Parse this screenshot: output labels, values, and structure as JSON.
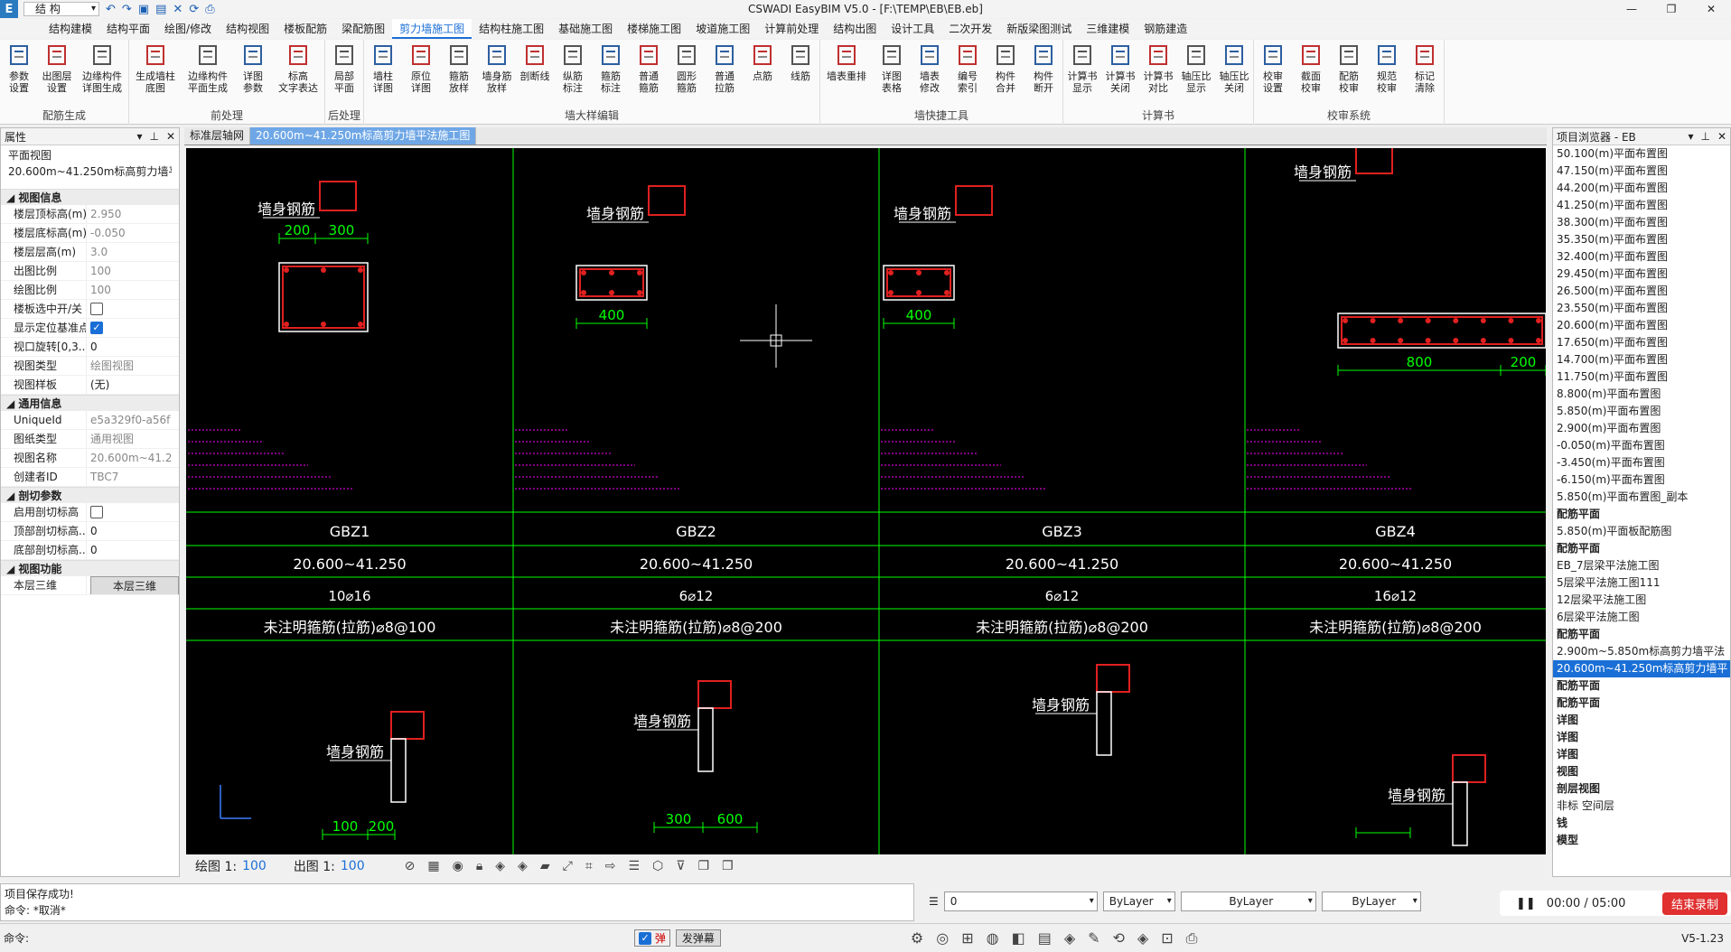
{
  "window": {
    "title": "CSWADI EasyBIM V5.0 - [F:\\TEMP\\EB\\EB.eb]",
    "profile": "结 构",
    "app_icon": "E"
  },
  "tabs": [
    "结构建模",
    "结构平面",
    "绘图/修改",
    "结构视图",
    "楼板配筋",
    "梁配筋图",
    "剪力墙施工图",
    "结构柱施工图",
    "基础施工图",
    "楼梯施工图",
    "坡道施工图",
    "计算前处理",
    "结构出图",
    "设计工具",
    "二次开发",
    "新版梁图测试",
    "三维建模",
    "钢筋建造"
  ],
  "active_tab": 6,
  "ribbon": [
    {
      "label": "配筋生成",
      "buttons": [
        "参数\n设置",
        "出图层\n设置",
        "边缘构件\n详图生成"
      ],
      "wide": [
        false,
        false,
        true
      ]
    },
    {
      "label": "前处理",
      "buttons": [
        "生成墙柱\n底图",
        "边缘构件\n平面生成",
        "详图\n参数",
        "标高\n文字表达"
      ],
      "wide": [
        true,
        true,
        false,
        true
      ]
    },
    {
      "label": "后处理",
      "buttons": [
        "局部\n平面"
      ],
      "wide": [
        false
      ]
    },
    {
      "label": "墙大样编辑",
      "buttons": [
        "墙柱\n详图",
        "原位\n详图",
        "箍筋\n放样",
        "墙身筋\n放样",
        "剖断线",
        "纵筋\n标注",
        "箍筋\n标注",
        "普通\n箍筋",
        "圆形\n箍筋",
        "普通\n拉筋",
        "点筋",
        "线筋"
      ],
      "wide": [
        false,
        false,
        false,
        false,
        false,
        false,
        false,
        false,
        false,
        false,
        false,
        false
      ]
    },
    {
      "label": "墙快捷工具",
      "buttons": [
        "墙表重排",
        "详图\n表格",
        "墙表\n修改",
        "编号\n索引",
        "构件\n合并",
        "构件\n断开"
      ],
      "wide": [
        true,
        false,
        false,
        false,
        false,
        false
      ]
    },
    {
      "label": "计算书",
      "buttons": [
        "计算书\n显示",
        "计算书\n关闭",
        "计算书\n对比",
        "轴压比\n显示",
        "轴压比\n关闭"
      ],
      "wide": [
        false,
        false,
        false,
        false,
        false
      ]
    },
    {
      "label": "校审系统",
      "buttons": [
        "校审\n设置",
        "截面\n校审",
        "配筋\n校审",
        "规范\n校审",
        "标记\n清除"
      ],
      "wide": [
        false,
        false,
        false,
        false,
        false
      ]
    }
  ],
  "props": {
    "title": "属性",
    "view_type_label": "平面视图",
    "view_name": "20.600m~41.250m标高剪力墙平法",
    "categories": [
      {
        "name": "视图信息",
        "rows": [
          [
            "楼层顶标高(m)",
            "2.950"
          ],
          [
            "楼层底标高(m)",
            "-0.050"
          ],
          [
            "楼层层高(m)",
            "3.0"
          ],
          [
            "出图比例",
            "100"
          ],
          [
            "绘图比例",
            "100"
          ],
          [
            "楼板选中开/关",
            "☐"
          ],
          [
            "显示定位基准点",
            "☑"
          ],
          [
            "视口旋转[0,3...",
            "0"
          ],
          [
            "视图类型",
            "绘图视图"
          ],
          [
            "视图样板",
            "(无)"
          ]
        ]
      },
      {
        "name": "通用信息",
        "rows": [
          [
            "UniqueId",
            "e5a329f0-a56f"
          ],
          [
            "图纸类型",
            "通用视图"
          ],
          [
            "视图名称",
            "20.600m~41.2"
          ],
          [
            "创建者ID",
            "TBC7"
          ]
        ]
      },
      {
        "name": "剖切参数",
        "rows": [
          [
            "启用剖切标高",
            "☐"
          ],
          [
            "顶部剖切标高...",
            "0"
          ],
          [
            "底部剖切标高...",
            "0"
          ]
        ]
      },
      {
        "name": "视图功能",
        "rows": [
          [
            "本层三维",
            "本层三维"
          ]
        ]
      }
    ]
  },
  "doc_tabs": [
    "标准层轴网",
    "20.600m~41.250m标高剪力墙平法施工图"
  ],
  "tree": {
    "title": "项目浏览器 - EB",
    "items": [
      "50.100(m)平面布置图",
      "47.150(m)平面布置图",
      "44.200(m)平面布置图",
      "41.250(m)平面布置图",
      "38.300(m)平面布置图",
      "35.350(m)平面布置图",
      "32.400(m)平面布置图",
      "29.450(m)平面布置图",
      "26.500(m)平面布置图",
      "23.550(m)平面布置图",
      "20.600(m)平面布置图",
      "17.650(m)平面布置图",
      "14.700(m)平面布置图",
      "11.750(m)平面布置图",
      "8.800(m)平面布置图",
      "5.850(m)平面布置图",
      "2.900(m)平面布置图",
      "-0.050(m)平面布置图",
      "-3.450(m)平面布置图",
      "-6.150(m)平面布置图",
      "5.850(m)平面布置图_副本",
      "配筋平面",
      "5.850(m)平面板配筋图",
      "配筋平面",
      "EB_7层梁平法施工图",
      "5层梁平法施工图111",
      "12层梁平法施工图",
      "6层梁平法施工图",
      "配筋平面",
      "2.900m~5.850m标高剪力墙平法",
      "20.600m~41.250m标高剪力墙平",
      "配筋平面",
      "配筋平面",
      "详图",
      "详图",
      "详图",
      "视图",
      "剖层视图",
      "非标 空间层",
      "钱",
      "模型"
    ],
    "selected": 30,
    "bold": [
      21,
      23,
      28,
      31,
      32,
      33,
      34,
      35,
      36,
      37,
      39,
      40
    ]
  },
  "drawing": {
    "label": "墙身钢筋",
    "codes": [
      "GBZ1",
      "GBZ2",
      "GBZ3",
      "GBZ4"
    ],
    "elev": "20.600~41.250",
    "bars": [
      "10⌀16",
      "6⌀12",
      "6⌀12",
      "16⌀12"
    ],
    "stirrups": [
      "未注明箍筋(拉筋)⌀8@100",
      "未注明箍筋(拉筋)⌀8@200",
      "未注明箍筋(拉筋)⌀8@200",
      "未注明箍筋(拉筋)⌀8@200"
    ],
    "dims": [
      "200",
      "300",
      "400",
      "400",
      "200",
      "400",
      "200",
      "800",
      "200",
      "200",
      "100",
      "200",
      "300",
      "600"
    ]
  },
  "canvas_bar": {
    "draw_label": "绘图 1:",
    "draw_val": "100",
    "out_label": "出图 1:",
    "out_val": "100"
  },
  "cmd": {
    "line1": "项目保存成功!",
    "line2": "命令: *取消*",
    "prompt": "命令:"
  },
  "layer": {
    "color": "0",
    "b1": "ByLayer",
    "b2": "ByLayer",
    "b3": "ByLayer"
  },
  "recorder": {
    "time": "00:00 / 05:00",
    "stop": "结束录制"
  },
  "status": {
    "toggle1": "弹",
    "toggle2": "发弹幕",
    "version": "V5-1.23"
  }
}
